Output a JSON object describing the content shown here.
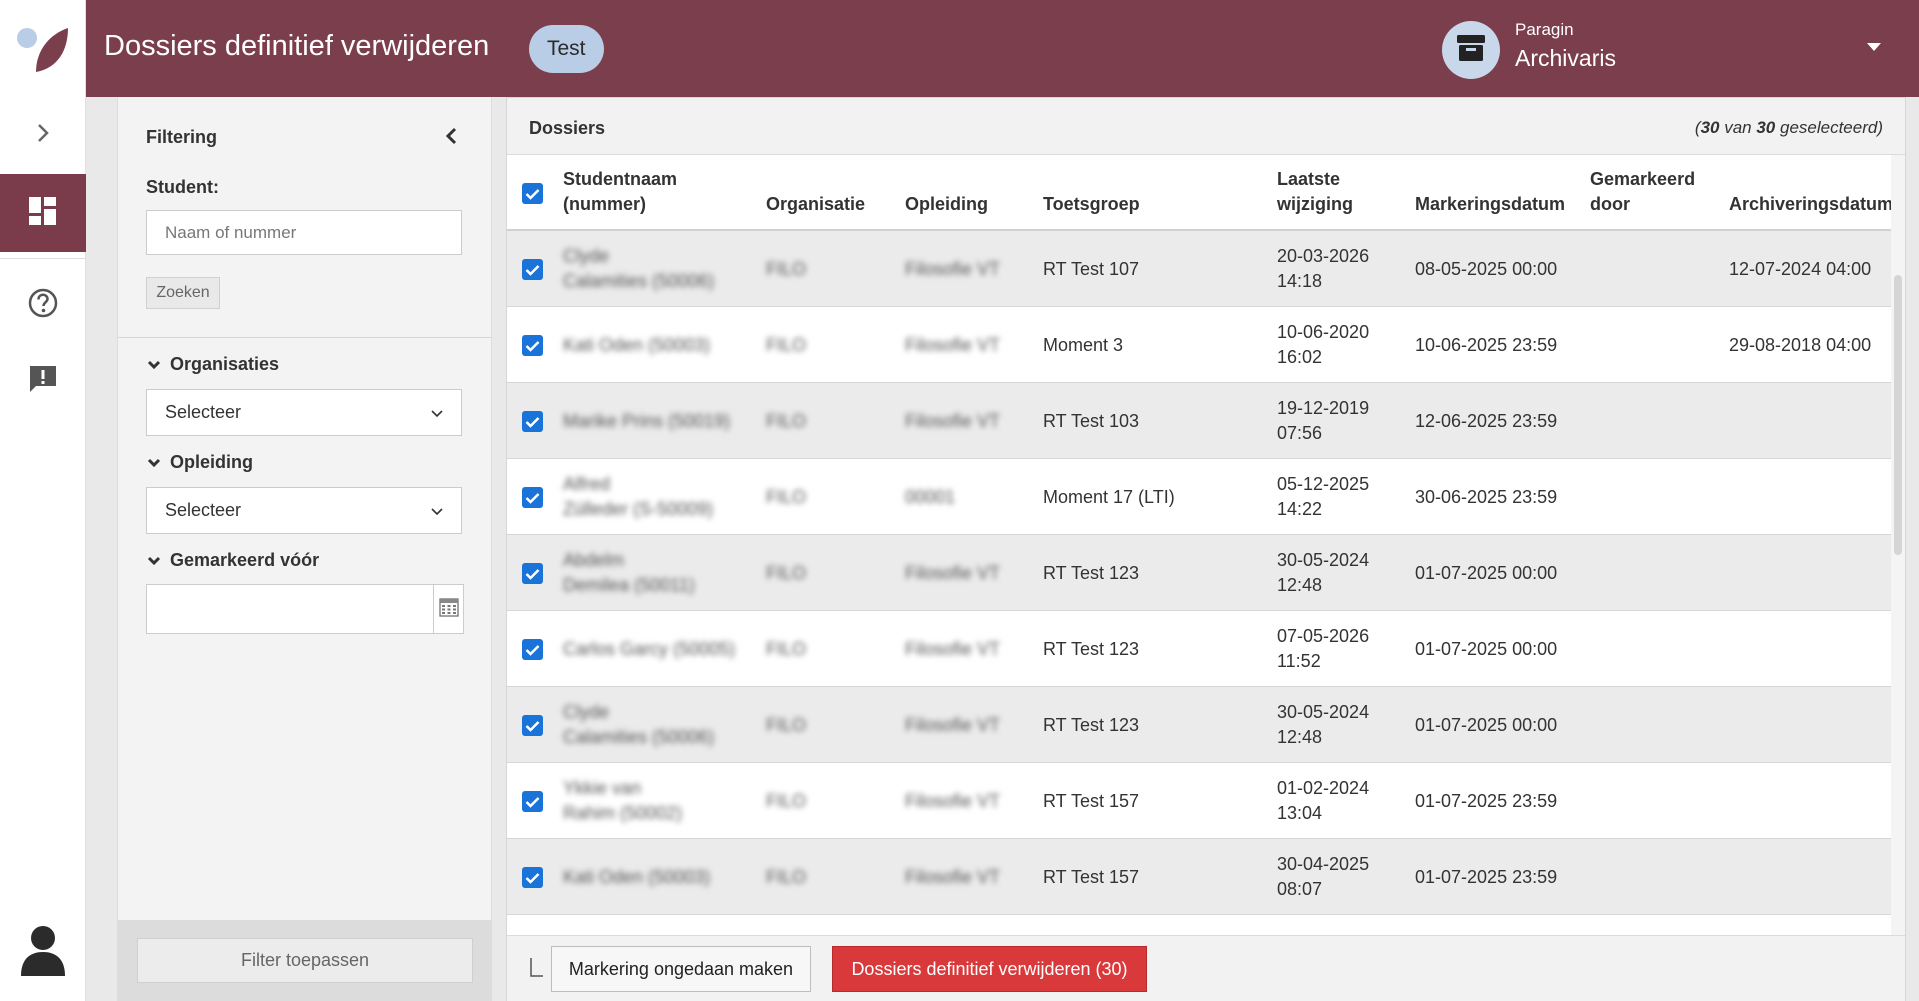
{
  "rail": {
    "icons": [
      "logo",
      "chevron-right-icon",
      "dashboard-icon",
      "help-icon",
      "feedback-icon",
      "user-avatar-icon"
    ]
  },
  "header": {
    "title": "Dossiers definitief verwijderen",
    "env_badge": "Test",
    "org": "Paragin",
    "role": "Archivaris",
    "brand_color": "#7b3e4d"
  },
  "filter": {
    "title": "Filtering",
    "student_label": "Student:",
    "student_placeholder": "Naam of nummer",
    "search_label": "Zoeken",
    "organisations_label": "Organisaties",
    "organisations_value": "Selecteer",
    "programme_label": "Opleiding",
    "programme_value": "Selecteer",
    "marked_before_label": "Gemarkeerd vóór",
    "marked_before_value": "",
    "apply_label": "Filter toepassen"
  },
  "dossiers": {
    "title": "Dossiers",
    "selected_count": "30",
    "selected_total": "30",
    "selected_prefix": "(",
    "selected_mid": " van ",
    "selected_suffix": " geselecteerd)",
    "columns": {
      "student": [
        "Studentnaam",
        "(nummer)"
      ],
      "organisation": "Organisatie",
      "programme": "Opleiding",
      "testgroup": "Toetsgroep",
      "last_change": [
        "Laatste",
        "wijziging"
      ],
      "marking_date": "Markeringsdatum",
      "marked_by": [
        "Gemarkeerd",
        "door"
      ],
      "archive_date": "Archiveringsdatum"
    },
    "rows": [
      {
        "student": [
          "Clyde",
          "Calamities (50006)"
        ],
        "org": "FILO",
        "prog": "Filosofie VT",
        "group": "RT Test 107",
        "changed": [
          "20-03-2026",
          "14:18"
        ],
        "marked": "08-05-2025 00:00",
        "by": "",
        "archived": "12-07-2024 04:00"
      },
      {
        "student": [
          "Kati Oden (50003)"
        ],
        "org": "FILO",
        "prog": "Filosofie VT",
        "group": "Moment 3",
        "changed": [
          "10-06-2020",
          "16:02"
        ],
        "marked": "10-06-2025 23:59",
        "by": "",
        "archived": "29-08-2018 04:00"
      },
      {
        "student": [
          "Marike Prins (50019)"
        ],
        "org": "FILO",
        "prog": "Filosofie VT",
        "group": "RT Test 103",
        "changed": [
          "19-12-2019",
          "07:56"
        ],
        "marked": "12-06-2025 23:59",
        "by": "",
        "archived": ""
      },
      {
        "student": [
          "Alfred",
          "Zülleder (S-50009)"
        ],
        "org": "FILO",
        "prog": "00001",
        "group": "Moment 17 (LTI)",
        "changed": [
          "05-12-2025",
          "14:22"
        ],
        "marked": "30-06-2025 23:59",
        "by": "",
        "archived": ""
      },
      {
        "student": [
          "Abdelm",
          "Demilea (50011)"
        ],
        "org": "FILO",
        "prog": "Filosofie VT",
        "group": "RT Test 123",
        "changed": [
          "30-05-2024",
          "12:48"
        ],
        "marked": "01-07-2025 00:00",
        "by": "",
        "archived": ""
      },
      {
        "student": [
          "Carlos Garcy (50005)"
        ],
        "org": "FILO",
        "prog": "Filosofie VT",
        "group": "RT Test 123",
        "changed": [
          "07-05-2026",
          "11:52"
        ],
        "marked": "01-07-2025 00:00",
        "by": "",
        "archived": ""
      },
      {
        "student": [
          "Clyde",
          "Calamities (50006)"
        ],
        "org": "FILO",
        "prog": "Filosofie VT",
        "group": "RT Test 123",
        "changed": [
          "30-05-2024",
          "12:48"
        ],
        "marked": "01-07-2025 00:00",
        "by": "",
        "archived": ""
      },
      {
        "student": [
          "Ykkie van",
          "Rahim (50002)"
        ],
        "org": "FILO",
        "prog": "Filosofie VT",
        "group": "RT Test 157",
        "changed": [
          "01-02-2024",
          "13:04"
        ],
        "marked": "01-07-2025 23:59",
        "by": "",
        "archived": ""
      },
      {
        "student": [
          "Kati Oden (50003)"
        ],
        "org": "FILO",
        "prog": "Filosofie VT",
        "group": "RT Test 157",
        "changed": [
          "30-04-2025",
          "08:07"
        ],
        "marked": "01-07-2025 23:59",
        "by": "",
        "archived": ""
      }
    ]
  },
  "footer": {
    "undo_label": "Markering ongedaan maken",
    "delete_label": "Dossiers definitief verwijderen (30)",
    "delete_color": "#d9393a"
  }
}
